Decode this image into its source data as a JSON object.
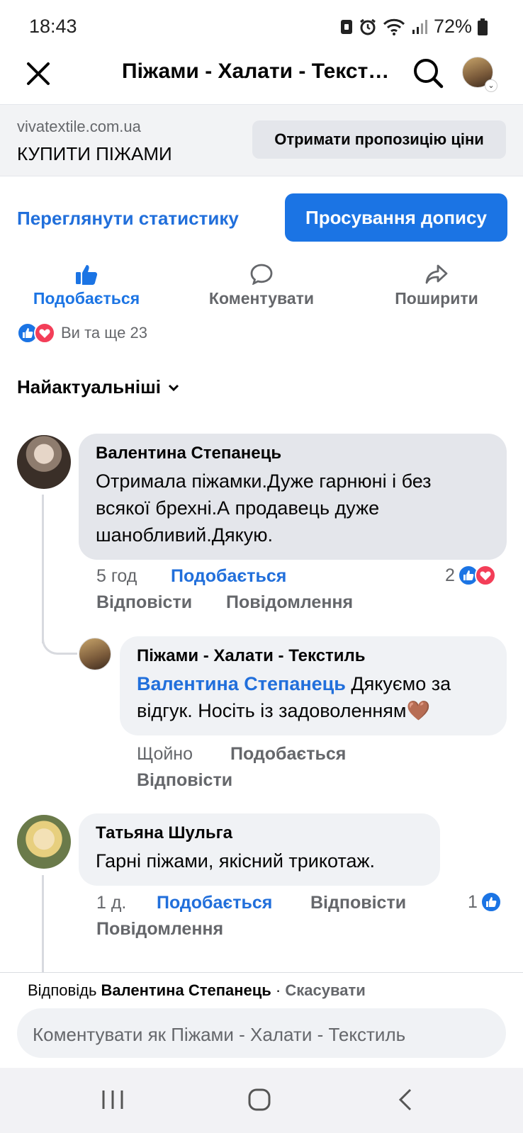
{
  "status": {
    "time": "18:43",
    "battery": "72%"
  },
  "header": {
    "title": "Піжами - Халати - Текстиль"
  },
  "ad": {
    "domain": "vivatextile.com.ua",
    "headline": "КУПИТИ ПІЖАМИ",
    "cta": "Отримати пропозицію ціни"
  },
  "actions": {
    "stats": "Переглянути статистику",
    "boost": "Просування допису",
    "like": "Подобається",
    "comment": "Коментувати",
    "share": "Поширити"
  },
  "reactions_summary": "Ви та ще 23",
  "sort_label": "Найактуальніші",
  "comments": [
    {
      "author": "Валентина Степанець",
      "text": "Отримала піжамки.Дуже гарнюні і без всякої брехні.А продавець дуже шанобливий.Дякую.",
      "time": "5 год",
      "like": "Подобається",
      "reply": "Відповісти",
      "message": "Повідомлення",
      "reaction_count": "2"
    },
    {
      "author": "Піжами - Халати - Текстиль",
      "mention": "Валентина Степанець",
      "text": " Дякуємо за відгук. Носіть із задоволенням🤎",
      "time": "Щойно",
      "like": "Подобається",
      "reply": "Відповісти"
    },
    {
      "author": "Татьяна Шульга",
      "text": "Гарні піжами, якісний трикотаж.",
      "time": "1 д.",
      "like": "Подобається",
      "reply": "Відповісти",
      "message": "Повідомлення",
      "reaction_count": "1"
    }
  ],
  "reply_bar": {
    "prefix": "Відповідь",
    "name": "Валентина Степанець",
    "sep": " · ",
    "cancel": "Скасувати",
    "placeholder": "Коментувати як Піжами - Халати - Текстиль"
  },
  "colors": {
    "accent": "#1b74e4",
    "link": "#216fdb",
    "love": "#f33e58"
  }
}
